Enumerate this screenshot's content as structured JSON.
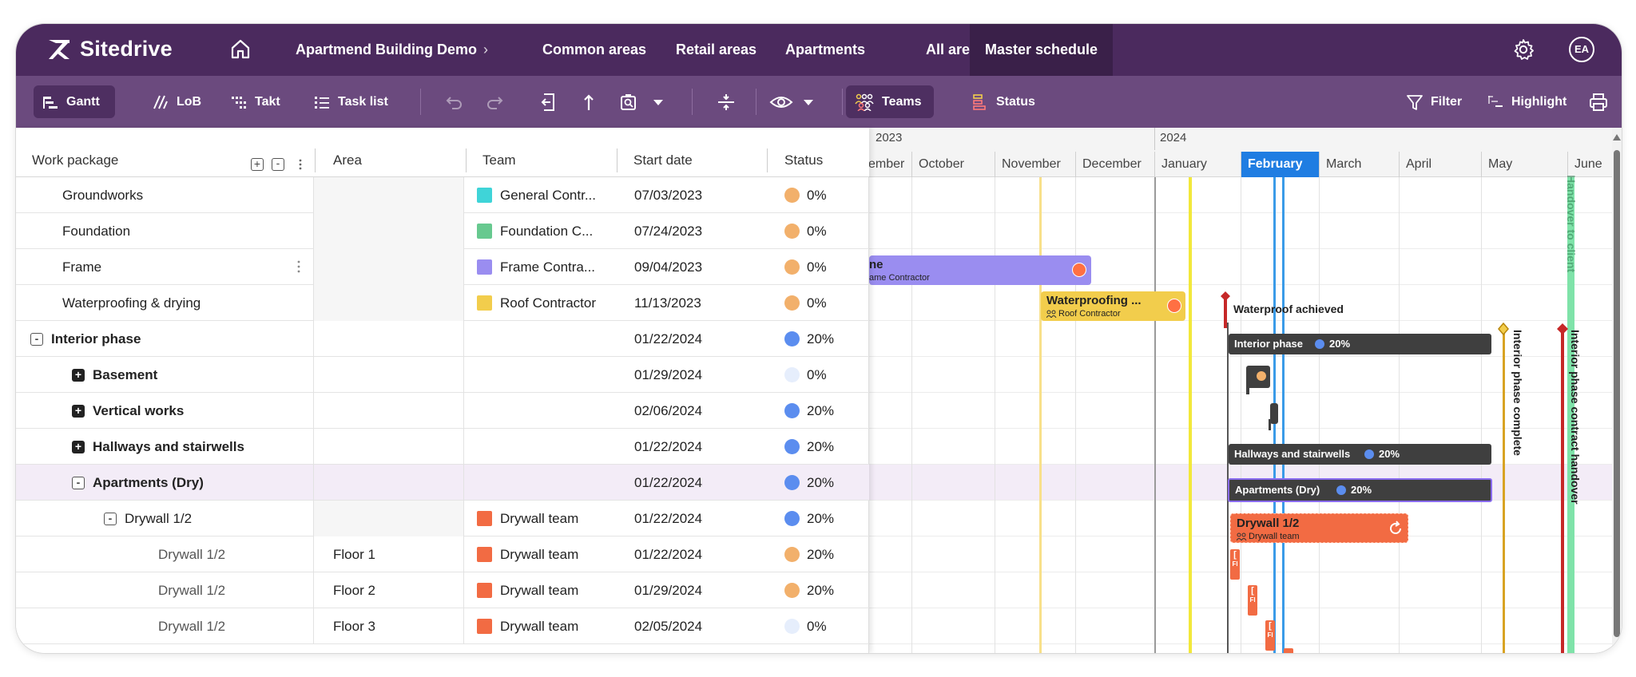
{
  "nav": {
    "brand": "Sitedrive",
    "breadcrumb_project": "Apartmend Building Demo",
    "tabs": [
      {
        "label": "Common areas"
      },
      {
        "label": "Retail areas"
      },
      {
        "label": "Apartments"
      },
      {
        "label": "All areas"
      },
      {
        "label": "Master schedule",
        "active": true
      }
    ],
    "avatar_initials": "EA",
    "icons": {
      "home": "home-icon",
      "settings": "gear-icon"
    }
  },
  "toolbar": {
    "views": [
      {
        "label": "Gantt",
        "icon": "gantt-icon",
        "active": true
      },
      {
        "label": "LoB",
        "icon": "lob-icon"
      },
      {
        "label": "Takt",
        "icon": "takt-icon"
      },
      {
        "label": "Task list",
        "icon": "list-icon"
      }
    ],
    "teams_label": "Teams",
    "status_label": "Status",
    "filter_label": "Filter",
    "highlight_label": "Highlight"
  },
  "table": {
    "columns": [
      "Work package",
      "Area",
      "Team",
      "Start date",
      "Status"
    ],
    "rows": [
      {
        "name": "Groundworks",
        "area": "",
        "team": "General Contr...",
        "team_color": "#3fd4d8",
        "start": "07/03/2023",
        "status": "0%",
        "status_color": "#f2b06b",
        "indent": 1,
        "bold": false,
        "expander": ""
      },
      {
        "name": "Foundation",
        "area": "",
        "team": "Foundation C...",
        "team_color": "#67c98f",
        "start": "07/24/2023",
        "status": "0%",
        "status_color": "#f2b06b",
        "indent": 1,
        "bold": false,
        "expander": ""
      },
      {
        "name": "Frame",
        "area": "",
        "team": "Frame Contra...",
        "team_color": "#9a8df0",
        "start": "09/04/2023",
        "status": "0%",
        "status_color": "#f2b06b",
        "indent": 1,
        "bold": false,
        "expander": "",
        "menu": true
      },
      {
        "name": "Waterproofing & drying",
        "area": "",
        "team": "Roof Contractor",
        "team_color": "#f2cd4c",
        "start": "11/13/2023",
        "status": "0%",
        "status_color": "#f2b06b",
        "indent": 1,
        "bold": false,
        "expander": ""
      },
      {
        "name": "Interior phase",
        "area": "",
        "team": "",
        "team_color": "",
        "start": "01/22/2024",
        "status": "20%",
        "status_color": "#5b8def",
        "indent": 0,
        "bold": true,
        "expander": "minus"
      },
      {
        "name": "Basement",
        "area": "",
        "team": "",
        "team_color": "",
        "start": "01/29/2024",
        "status": "0%",
        "status_color": "#e6eefc",
        "indent": 2,
        "bold": true,
        "expander": "plus"
      },
      {
        "name": "Vertical works",
        "area": "",
        "team": "",
        "team_color": "",
        "start": "02/06/2024",
        "status": "20%",
        "status_color": "#5b8def",
        "indent": 2,
        "bold": true,
        "expander": "plus"
      },
      {
        "name": "Hallways and stairwells",
        "area": "",
        "team": "",
        "team_color": "",
        "start": "01/22/2024",
        "status": "20%",
        "status_color": "#5b8def",
        "indent": 2,
        "bold": true,
        "expander": "plus"
      },
      {
        "name": "Apartments (Dry)",
        "area": "",
        "team": "",
        "team_color": "",
        "start": "01/22/2024",
        "status": "20%",
        "status_color": "#5b8def",
        "indent": 2,
        "bold": true,
        "expander": "minus",
        "selected": true
      },
      {
        "name": "Drywall 1/2",
        "area": "",
        "team": "Drywall team",
        "team_color": "#f26b43",
        "start": "01/22/2024",
        "status": "20%",
        "status_color": "#5b8def",
        "indent": 3,
        "bold": false,
        "expander": "minus"
      },
      {
        "name": "Drywall 1/2",
        "area": "Floor 1",
        "team": "Drywall team",
        "team_color": "#f26b43",
        "start": "01/22/2024",
        "status": "20%",
        "status_color": "#f2b06b",
        "indent": 4,
        "bold": false,
        "expander": "",
        "sub": true
      },
      {
        "name": "Drywall 1/2",
        "area": "Floor 2",
        "team": "Drywall team",
        "team_color": "#f26b43",
        "start": "01/29/2024",
        "status": "20%",
        "status_color": "#f2b06b",
        "indent": 4,
        "bold": false,
        "expander": "",
        "sub": true
      },
      {
        "name": "Drywall 1/2",
        "area": "Floor 3",
        "team": "Drywall team",
        "team_color": "#f26b43",
        "start": "02/05/2024",
        "status": "0%",
        "status_color": "#e6eefc",
        "indent": 4,
        "bold": false,
        "expander": "",
        "sub": true
      }
    ]
  },
  "gantt": {
    "years": [
      "2023",
      "2024"
    ],
    "months": [
      {
        "label": "ember"
      },
      {
        "label": "October"
      },
      {
        "label": "November"
      },
      {
        "label": "December"
      },
      {
        "label": "January"
      },
      {
        "label": "February",
        "current": true
      },
      {
        "label": "March"
      },
      {
        "label": "April"
      },
      {
        "label": "May"
      },
      {
        "label": "June"
      }
    ],
    "frame_bar": {
      "title": "ne",
      "team": "ame Contractor"
    },
    "waterproof_bar": {
      "title": "Waterproofing ...",
      "team": "Roof Contractor"
    },
    "waterproof_milestone": "Waterproof achieved",
    "interior_bar": {
      "label": "Interior phase",
      "pct": "20%"
    },
    "hallways_bar": {
      "label": "Hallways and stairwells",
      "pct": "20%"
    },
    "apartments_bar": {
      "label": "Apartments (Dry)",
      "pct": "20%"
    },
    "drywall_bar": {
      "title": "Drywall 1/2",
      "team": "Drywall team"
    },
    "vertical_labels": {
      "interior_complete": "Interior phase complete",
      "interior_handover": "Interior phase contract handover",
      "handover_green": "Handover to client"
    },
    "floor_tag": "Fl",
    "colors": {
      "frame": "#9a8df0",
      "roof": "#f2cd4c",
      "drywall": "#f26b43",
      "summary": "#3f3f3f",
      "current_month": "#1f7de2"
    }
  }
}
